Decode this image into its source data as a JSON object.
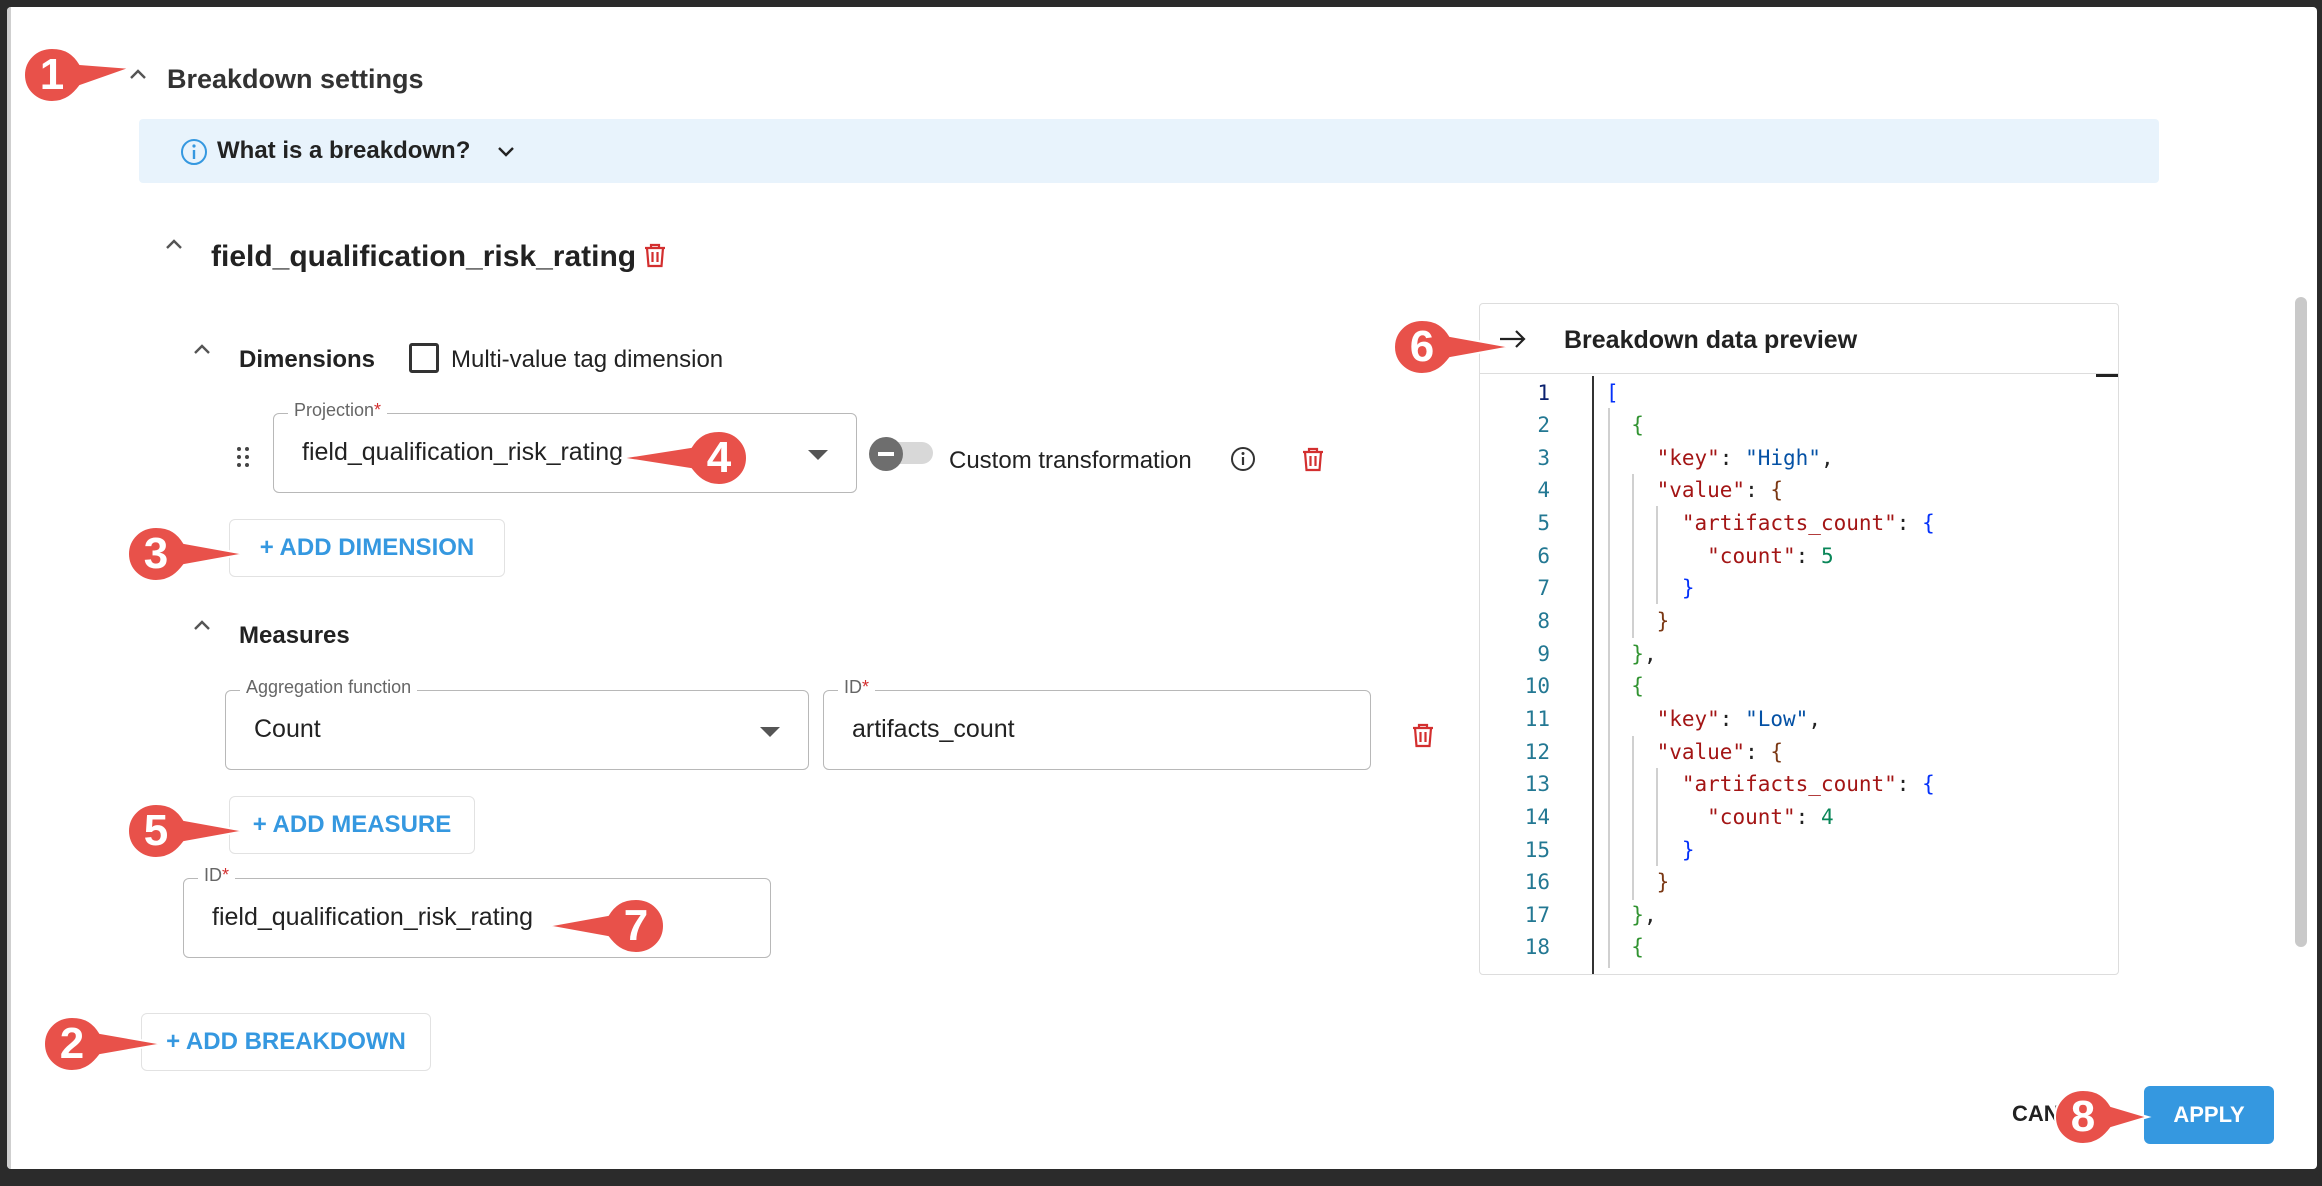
{
  "dialog": {
    "section_title": "Breakdown settings",
    "info_text": "What is a breakdown?",
    "breakdown_name": "field_qualification_risk_rating",
    "dimensions_label": "Dimensions",
    "multi_value_label": "Multi-value tag dimension",
    "projection": {
      "label": "Projection",
      "required": "*",
      "value": "field_qualification_risk_rating"
    },
    "custom_transformation_label": "Custom transformation",
    "add_dimension_label": "+ ADD DIMENSION",
    "measures_label": "Measures",
    "aggregation": {
      "label": "Aggregation function",
      "value": "Count"
    },
    "measure_id": {
      "label": "ID",
      "required": "*",
      "value": "artifacts_count"
    },
    "add_measure_label": "+ ADD MEASURE",
    "breakdown_id": {
      "label": "ID",
      "required": "*",
      "value": "field_qualification_risk_rating"
    },
    "add_breakdown_label": "+ ADD BREAKDOWN",
    "cancel_label": "CANCEL",
    "apply_label": "APPLY"
  },
  "preview": {
    "title": "Breakdown data preview",
    "line_numbers": [
      "1",
      "2",
      "3",
      "4",
      "5",
      "6",
      "7",
      "8",
      "9",
      "10",
      "11",
      "12",
      "13",
      "14",
      "15",
      "16",
      "17",
      "18"
    ]
  },
  "markers": [
    "1",
    "2",
    "3",
    "4",
    "5",
    "6",
    "7",
    "8"
  ],
  "colors": {
    "accent": "#3598e0",
    "marker": "#e8514a",
    "info_bg": "#e8f3fc",
    "danger": "#d32f2f"
  },
  "icons": {
    "collapse": "chevron-up-icon",
    "info": "info-circle-icon",
    "expand": "chevron-down-icon",
    "delete": "trash-icon",
    "drag": "drag-handle-icon",
    "arrow": "arrow-right-icon"
  }
}
